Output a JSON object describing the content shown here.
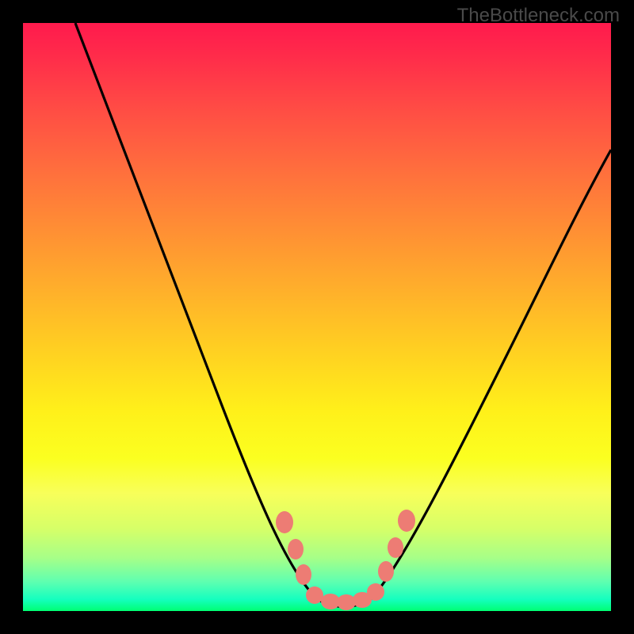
{
  "watermark": {
    "text": "TheBottleneck.com"
  },
  "chart_data": {
    "type": "line",
    "title": "",
    "xlabel": "",
    "ylabel": "",
    "xlim": [
      0,
      100
    ],
    "ylim": [
      0,
      100
    ],
    "grid": false,
    "legend": false,
    "background_gradient": {
      "top_color": "#ff1a4d",
      "mid_color": "#ffe020",
      "bottom_color": "#00ff73"
    },
    "series": [
      {
        "name": "bottleneck-curve",
        "color": "#000000",
        "x": [
          9,
          12,
          15,
          18,
          22,
          26,
          30,
          34,
          38,
          42,
          46,
          48,
          50,
          52,
          54,
          56,
          58,
          62,
          66,
          70,
          74,
          78,
          82,
          86,
          90,
          94,
          98,
          100
        ],
        "y": [
          100,
          93,
          86,
          79,
          71,
          63,
          55,
          47,
          39,
          31,
          22,
          16,
          10,
          5,
          2,
          1,
          1,
          5,
          12,
          20,
          28,
          36,
          43,
          50,
          57,
          63,
          69,
          72
        ]
      }
    ],
    "markers": [
      {
        "name": "trough-markers",
        "color": "#ed7c74",
        "shape": "rounded-hex",
        "x": [
          44.5,
          46.5,
          48,
          50,
          52,
          54,
          56,
          58,
          60,
          62.5,
          64.5
        ],
        "y": [
          15,
          10,
          6,
          2.5,
          2,
          2,
          2,
          2.5,
          6,
          10,
          15
        ]
      }
    ]
  }
}
